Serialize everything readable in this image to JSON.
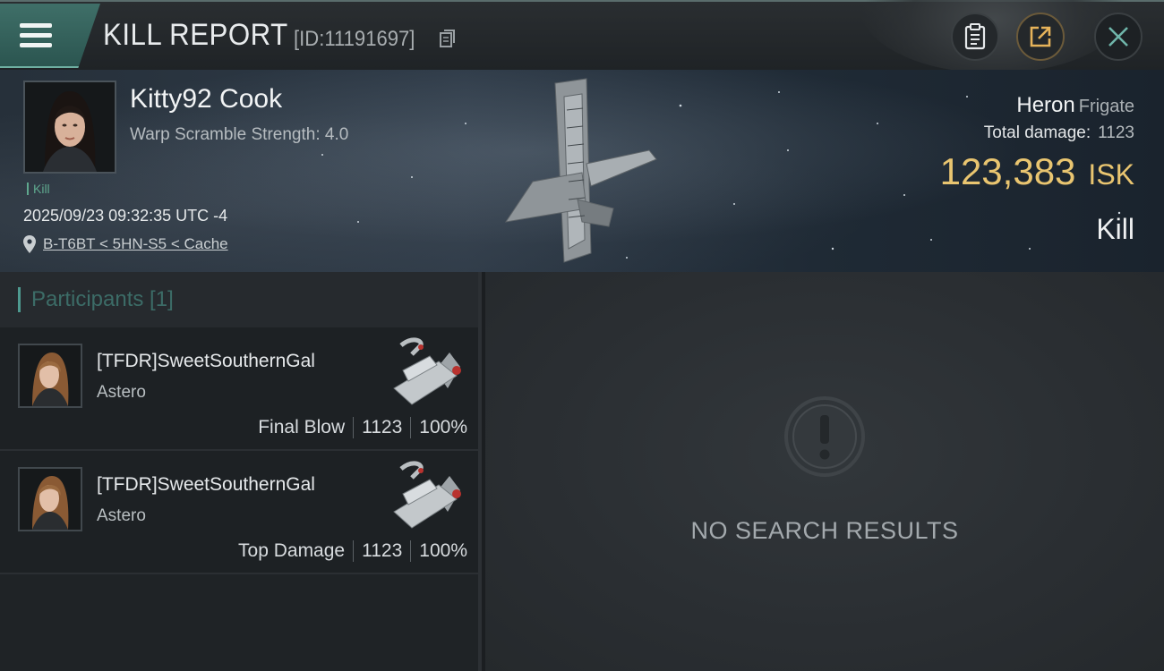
{
  "header": {
    "title": "KILL REPORT",
    "report_id": "[ID:11191697]",
    "icons": [
      "menu-icon",
      "copy-icon",
      "clipboard-icon",
      "share-icon",
      "close-icon"
    ]
  },
  "victim": {
    "name": "Kitty92 Cook",
    "warp_scramble": "Warp Scramble Strength: 4.0",
    "tag": "Kill",
    "timestamp": "2025/09/23 09:32:35 UTC -4",
    "location": "B-T6BT < 5HN-S5 < Cache",
    "ship_name": "Heron",
    "ship_class": "Frigate",
    "total_damage_label": "Total damage:",
    "total_damage": "1123",
    "isk_value": "123,383",
    "isk_unit": "ISK",
    "result": "Kill"
  },
  "participants": {
    "header": "Participants [1]",
    "rows": [
      {
        "name": "[TFDR]SweetSouthernGal",
        "ship": "Astero",
        "role": "Final Blow",
        "damage": "1123",
        "percent": "100%"
      },
      {
        "name": "[TFDR]SweetSouthernGal",
        "ship": "Astero",
        "role": "Top Damage",
        "damage": "1123",
        "percent": "100%"
      }
    ]
  },
  "empty_state": {
    "text": "NO SEARCH RESULTS"
  },
  "colors": {
    "accent_teal": "#4e9a90",
    "isk_gold": "#e9c570",
    "kill_green": "#5fa88e"
  }
}
